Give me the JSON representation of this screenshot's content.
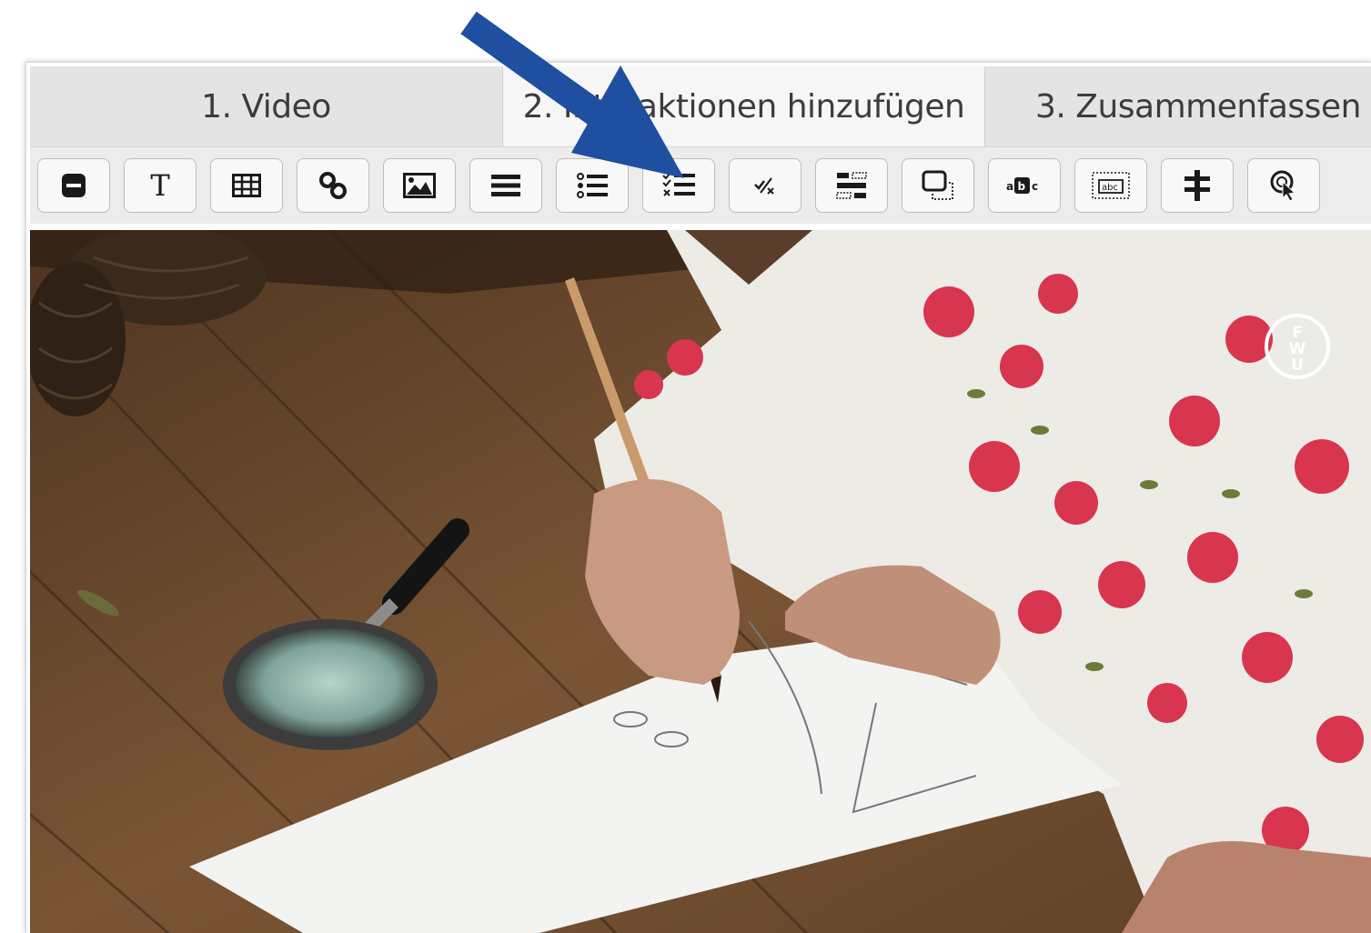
{
  "tabs": [
    {
      "label": "1. Video",
      "active": false
    },
    {
      "label": "2. Interaktionen hinzufügen",
      "active": true
    },
    {
      "label": "3. Zusammenfassen",
      "active": false
    }
  ],
  "toolbar": {
    "tools": [
      {
        "name": "label-tool",
        "icon": "minus-box-icon"
      },
      {
        "name": "text-tool",
        "icon": "text-T-icon",
        "glyph": "T"
      },
      {
        "name": "table-tool",
        "icon": "table-icon"
      },
      {
        "name": "link-tool",
        "icon": "link-icon"
      },
      {
        "name": "image-tool",
        "icon": "image-icon"
      },
      {
        "name": "statements-tool",
        "icon": "list-icon"
      },
      {
        "name": "single-choice-tool",
        "icon": "ordered-list-icon"
      },
      {
        "name": "multiple-choice-tool",
        "icon": "checklist-icon"
      },
      {
        "name": "true-false-tool",
        "icon": "check-cross-icon"
      },
      {
        "name": "drag-text-tool",
        "icon": "drag-rows-icon"
      },
      {
        "name": "drag-drop-tool",
        "icon": "drag-box-icon"
      },
      {
        "name": "mark-words-tool",
        "icon": "mark-words-icon"
      },
      {
        "name": "fill-blanks-tool",
        "icon": "blanks-abc-icon"
      },
      {
        "name": "crossroads-tool",
        "icon": "crossroads-icon"
      },
      {
        "name": "navigation-hotspot-tool",
        "icon": "hotspot-cursor-icon"
      }
    ]
  },
  "video": {
    "watermark_letters": "FWU"
  },
  "colors": {
    "arrow": "#1f4fa0",
    "tab_active": "#f6f6f6",
    "tab_inactive": "#e4e4e4",
    "toolbar_bg": "#ececec"
  }
}
